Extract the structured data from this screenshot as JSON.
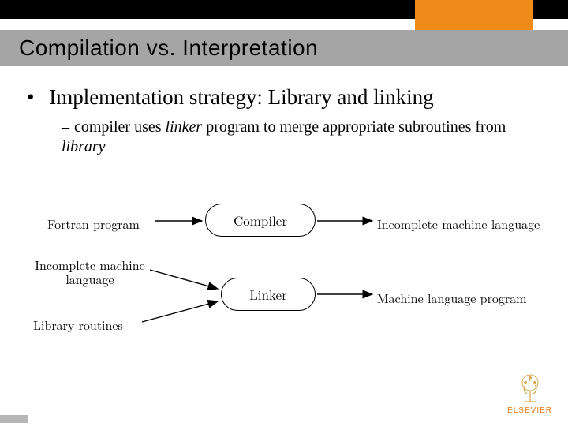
{
  "title": "Compilation vs. Interpretation",
  "bullets": {
    "main": "Implementation strategy: Library and linking",
    "sub_pre": "compiler uses ",
    "sub_italic1": "linker",
    "sub_mid": " program to merge appropriate subroutines from ",
    "sub_italic2": "library"
  },
  "diagram": {
    "inputs": {
      "fortran": "Fortran program",
      "incomplete_ml_l1": "Incomplete machine",
      "incomplete_ml_l2": "language",
      "library": "Library routines"
    },
    "stages": {
      "compiler": "Compiler",
      "linker": "Linker"
    },
    "outputs": {
      "incomplete_out": "Incomplete machine language",
      "mlp": "Machine language program"
    }
  },
  "logo": "ELSEVIER",
  "chart_data": {
    "type": "flow-diagram",
    "nodes": [
      {
        "id": "fortran",
        "label": "Fortran program",
        "kind": "input"
      },
      {
        "id": "compiler",
        "label": "Compiler",
        "kind": "process"
      },
      {
        "id": "incomplete_out",
        "label": "Incomplete machine language",
        "kind": "output"
      },
      {
        "id": "incomplete_in",
        "label": "Incomplete machine language",
        "kind": "input"
      },
      {
        "id": "library",
        "label": "Library routines",
        "kind": "input"
      },
      {
        "id": "linker",
        "label": "Linker",
        "kind": "process"
      },
      {
        "id": "mlp",
        "label": "Machine language program",
        "kind": "output"
      }
    ],
    "edges": [
      {
        "from": "fortran",
        "to": "compiler"
      },
      {
        "from": "compiler",
        "to": "incomplete_out"
      },
      {
        "from": "incomplete_in",
        "to": "linker"
      },
      {
        "from": "library",
        "to": "linker"
      },
      {
        "from": "linker",
        "to": "mlp"
      }
    ]
  }
}
